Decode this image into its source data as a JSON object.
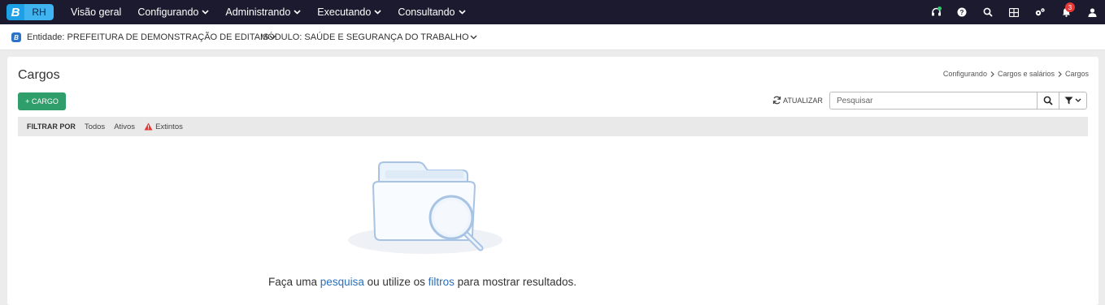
{
  "app": {
    "logo_letter": "B",
    "logo_module": "RH",
    "accent_color": "#1ea0e6"
  },
  "nav": {
    "items": [
      {
        "label": "Visão geral",
        "dropdown": false
      },
      {
        "label": "Configurando",
        "dropdown": true
      },
      {
        "label": "Administrando",
        "dropdown": true
      },
      {
        "label": "Executando",
        "dropdown": true
      },
      {
        "label": "Consultando",
        "dropdown": true
      }
    ],
    "right_icons": [
      "headset-icon",
      "help-icon",
      "search-icon",
      "apps-grid-icon",
      "settings-icon",
      "notifications-icon",
      "user-icon"
    ],
    "notification_count": "3"
  },
  "context": {
    "entity_label": "Entidade: PREFEITURA DE DEMONSTRAÇÃO DE EDITAIS",
    "module_label": "MÓDULO: SAÚDE E SEGURANÇA DO TRABALHO"
  },
  "page": {
    "title": "Cargos",
    "breadcrumb": [
      "Configurando",
      "Cargos e salários",
      "Cargos"
    ],
    "add_button": "+ CARGO",
    "refresh_label": "ATUALIZAR",
    "search_placeholder": "Pesquisar",
    "add_button_color": "#2f9e6a"
  },
  "filters": {
    "label": "FILTRAR POR",
    "options": [
      "Todos",
      "Ativos",
      "Extintos"
    ],
    "warning_color": "#e53935"
  },
  "empty_state": {
    "prefix": "Faça uma ",
    "link1": "pesquisa",
    "middle": " ou utilize os ",
    "link2": "filtros",
    "suffix": " para mostrar resultados."
  }
}
